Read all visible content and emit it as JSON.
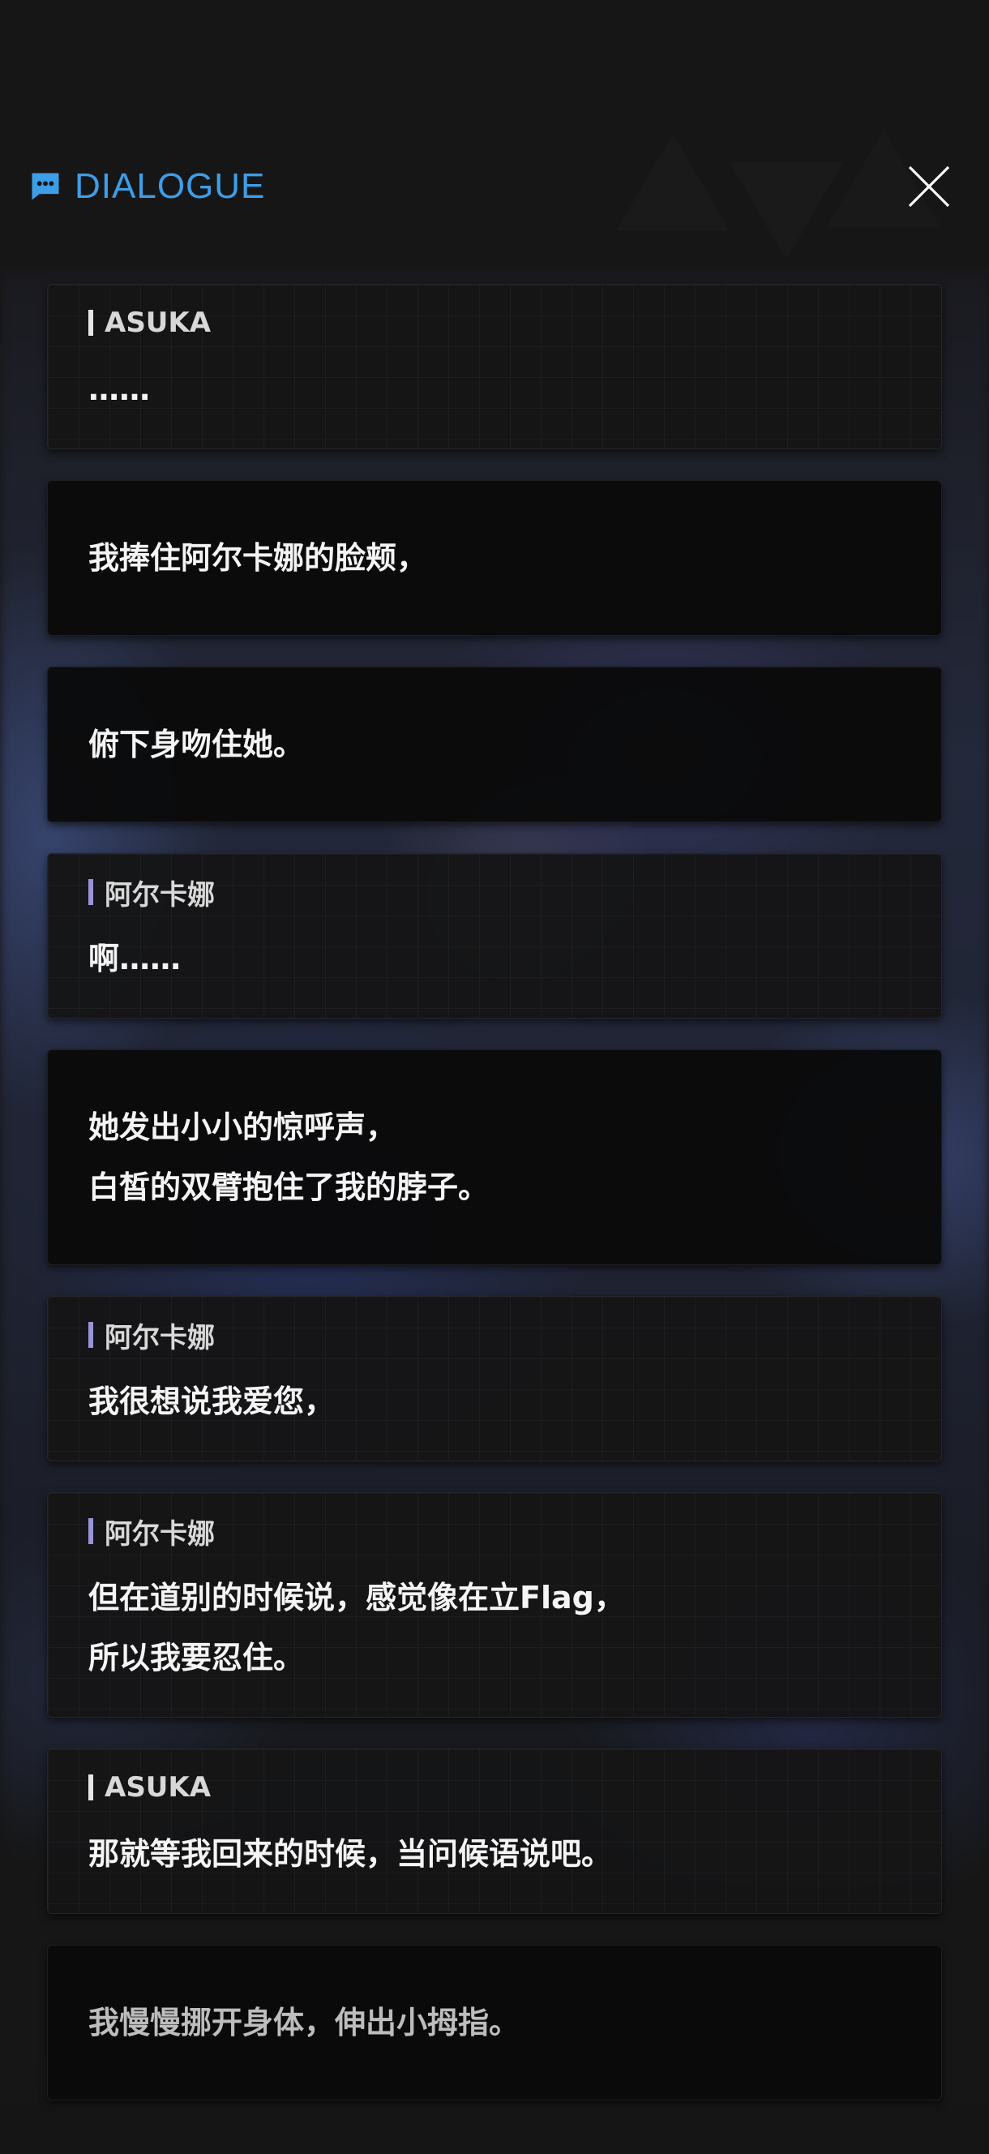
{
  "header": {
    "title": "DIALOGUE",
    "title_icon": "chat-icon",
    "close_icon": "close-icon",
    "accent_color": "#3d9ee8"
  },
  "entries": [
    {
      "type": "speech",
      "speaker": "ASUKA",
      "text": "……"
    },
    {
      "type": "narration",
      "text": "我捧住阿尔卡娜的脸颊，"
    },
    {
      "type": "narration",
      "text": "俯下身吻住她。"
    },
    {
      "type": "speech",
      "speaker": "阿尔卡娜",
      "text": "啊……"
    },
    {
      "type": "narration",
      "text": "她发出小小的惊呼声，\n白皙的双臂抱住了我的脖子。"
    },
    {
      "type": "speech",
      "speaker": "阿尔卡娜",
      "text": "我很想说我爱您，"
    },
    {
      "type": "speech",
      "speaker": "阿尔卡娜",
      "text": "但在道别的时候说，感觉像在立Flag，\n所以我要忍住。"
    },
    {
      "type": "speech",
      "speaker": "ASUKA",
      "text": "那就等我回来的时候，当问候语说吧。"
    },
    {
      "type": "narration",
      "text": "我慢慢挪开身体，伸出小拇指。"
    }
  ]
}
